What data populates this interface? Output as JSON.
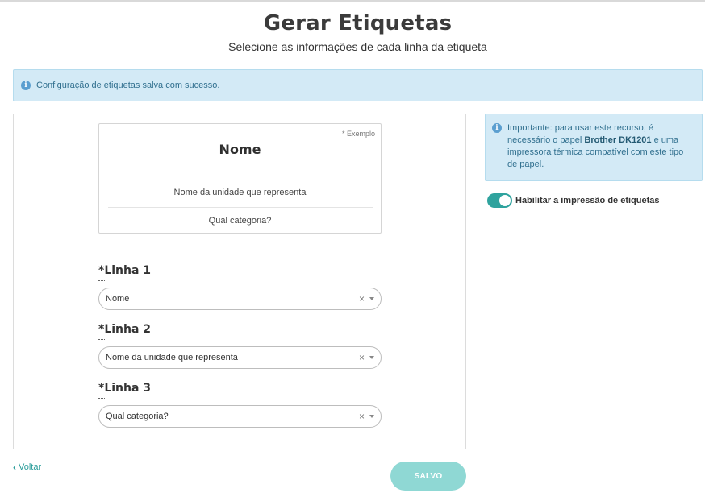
{
  "header": {
    "title": "Gerar Etiquetas",
    "subtitle": "Selecione as informações de cada linha da etiqueta"
  },
  "alert_success": {
    "icon": "info-icon",
    "text": "Configuração de etiquetas salva com sucesso."
  },
  "preview": {
    "example_tag": "* Exemplo",
    "title": "Nome",
    "line2": "Nome da unidade que representa",
    "line3": "Qual categoria?"
  },
  "lines": [
    {
      "label": "*Linha 1",
      "value": "Nome"
    },
    {
      "label": "*Linha 2",
      "value": "Nome da unidade que representa"
    },
    {
      "label": "*Linha 3",
      "value": "Qual categoria?"
    }
  ],
  "select_clear_glyph": "×",
  "info_panel": {
    "text_before": "Importante: para usar este recurso, é necessário o papel ",
    "bold": "Brother DK1201",
    "text_after": " e uma impressora térmica compatível com este tipo de papel."
  },
  "toggle": {
    "label": "Habilitar a impressão de etiquetas",
    "enabled": true,
    "color": "#2fa39e"
  },
  "footer": {
    "back_label": "Voltar",
    "save_label": "SALVO"
  },
  "colors": {
    "accent": "#2a9d9a",
    "alert_bg": "#d3eaf6",
    "save_button_bg": "#8fd8d4"
  }
}
